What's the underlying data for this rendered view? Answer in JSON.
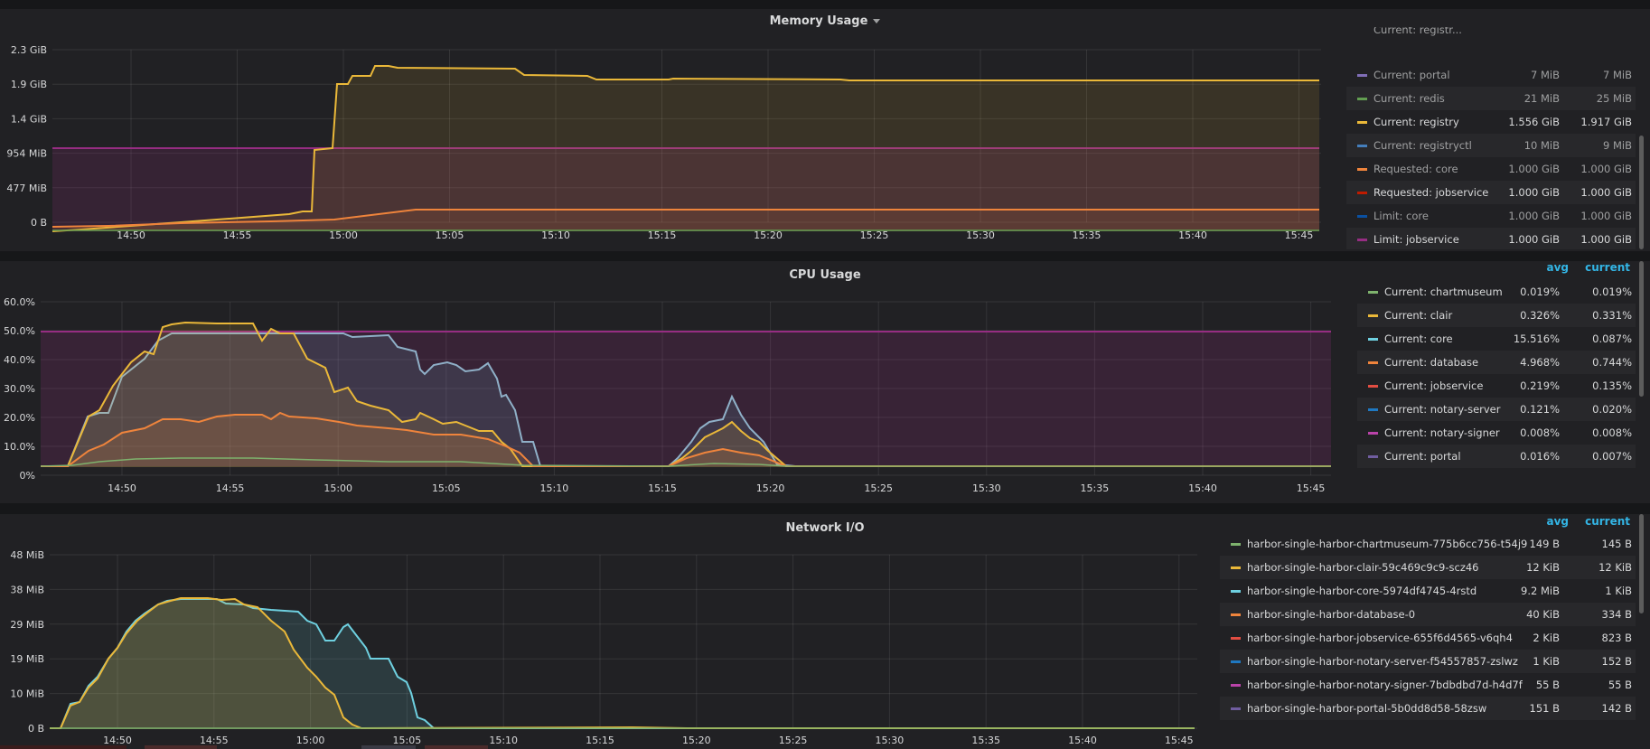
{
  "memory": {
    "title": "Memory Usage",
    "legend_partial_top": "Current: registr...",
    "y_ticks": [
      "2.3 GiB",
      "1.9 GiB",
      "1.4 GiB",
      "954 MiB",
      "477 MiB",
      "0 B"
    ],
    "x_ticks": [
      "14:50",
      "14:55",
      "15:00",
      "15:05",
      "15:10",
      "15:15",
      "15:20",
      "15:25",
      "15:30",
      "15:35",
      "15:40",
      "15:45"
    ],
    "legend": [
      {
        "name": "Current: portal",
        "v1": "7 MiB",
        "v2": "7 MiB",
        "color": "#806eb7"
      },
      {
        "name": "Current: redis",
        "v1": "21 MiB",
        "v2": "25 MiB",
        "color": "#629e51"
      },
      {
        "name": "Current: registry",
        "v1": "1.556 GiB",
        "v2": "1.917 GiB",
        "color": "#eab839"
      },
      {
        "name": "Current: registryctl",
        "v1": "10 MiB",
        "v2": "9 MiB",
        "color": "#447ebc"
      },
      {
        "name": "Requested: core",
        "v1": "1.000 GiB",
        "v2": "1.000 GiB",
        "color": "#ef843c"
      },
      {
        "name": "Requested: jobservice",
        "v1": "1.000 GiB",
        "v2": "1.000 GiB",
        "color": "#bf1b00"
      },
      {
        "name": "Limit: core",
        "v1": "1.000 GiB",
        "v2": "1.000 GiB",
        "color": "#0a50a1"
      },
      {
        "name": "Limit: jobservice",
        "v1": "1.000 GiB",
        "v2": "1.000 GiB",
        "color": "#962d82"
      }
    ]
  },
  "cpu": {
    "title": "CPU Usage",
    "y_ticks": [
      "60.0%",
      "50.0%",
      "40.0%",
      "30.0%",
      "20.0%",
      "10.0%",
      "0%"
    ],
    "x_ticks": [
      "14:50",
      "14:55",
      "15:00",
      "15:05",
      "15:10",
      "15:15",
      "15:20",
      "15:25",
      "15:30",
      "15:35",
      "15:40",
      "15:45"
    ],
    "legend_head": {
      "avg": "avg",
      "current": "current"
    },
    "legend": [
      {
        "name": "Current: chartmuseum",
        "v1": "0.019%",
        "v2": "0.019%",
        "color": "#7eb26d"
      },
      {
        "name": "Current: clair",
        "v1": "0.326%",
        "v2": "0.331%",
        "color": "#eab839"
      },
      {
        "name": "Current: core",
        "v1": "15.516%",
        "v2": "0.087%",
        "color": "#6ed0e0"
      },
      {
        "name": "Current: database",
        "v1": "4.968%",
        "v2": "0.744%",
        "color": "#ef843c"
      },
      {
        "name": "Current: jobservice",
        "v1": "0.219%",
        "v2": "0.135%",
        "color": "#e24d42"
      },
      {
        "name": "Current: notary-server",
        "v1": "0.121%",
        "v2": "0.020%",
        "color": "#1f78c1"
      },
      {
        "name": "Current: notary-signer",
        "v1": "0.008%",
        "v2": "0.008%",
        "color": "#ba43a9"
      },
      {
        "name": "Current: portal",
        "v1": "0.016%",
        "v2": "0.007%",
        "color": "#705da0"
      }
    ]
  },
  "network": {
    "title": "Network I/O",
    "y_ticks": [
      "48 MiB",
      "38 MiB",
      "29 MiB",
      "19 MiB",
      "10 MiB",
      "0 B"
    ],
    "x_ticks": [
      "14:50",
      "14:55",
      "15:00",
      "15:05",
      "15:10",
      "15:15",
      "15:20",
      "15:25",
      "15:30",
      "15:35",
      "15:40",
      "15:45"
    ],
    "legend_head": {
      "avg": "avg",
      "current": "current"
    },
    "legend": [
      {
        "name": "harbor-single-harbor-chartmuseum-775b6cc756-t54j9",
        "v1": "149 B",
        "v2": "145 B",
        "color": "#7eb26d"
      },
      {
        "name": "harbor-single-harbor-clair-59c469c9c9-scz46",
        "v1": "12 KiB",
        "v2": "12 KiB",
        "color": "#eab839"
      },
      {
        "name": "harbor-single-harbor-core-5974df4745-4rstd",
        "v1": "9.2 MiB",
        "v2": "1 KiB",
        "color": "#6ed0e0"
      },
      {
        "name": "harbor-single-harbor-database-0",
        "v1": "40 KiB",
        "v2": "334 B",
        "color": "#ef843c"
      },
      {
        "name": "harbor-single-harbor-jobservice-655f6d4565-v6qh4",
        "v1": "2 KiB",
        "v2": "823 B",
        "color": "#e24d42"
      },
      {
        "name": "harbor-single-harbor-notary-server-f54557857-zslwz",
        "v1": "1 KiB",
        "v2": "152 B",
        "color": "#1f78c1"
      },
      {
        "name": "harbor-single-harbor-notary-signer-7bdbdbd7d-h4d7f",
        "v1": "55 B",
        "v2": "55 B",
        "color": "#ba43a9"
      },
      {
        "name": "harbor-single-harbor-portal-5b0dd8d58-58zsw",
        "v1": "151 B",
        "v2": "142 B",
        "color": "#705da0"
      }
    ]
  }
}
